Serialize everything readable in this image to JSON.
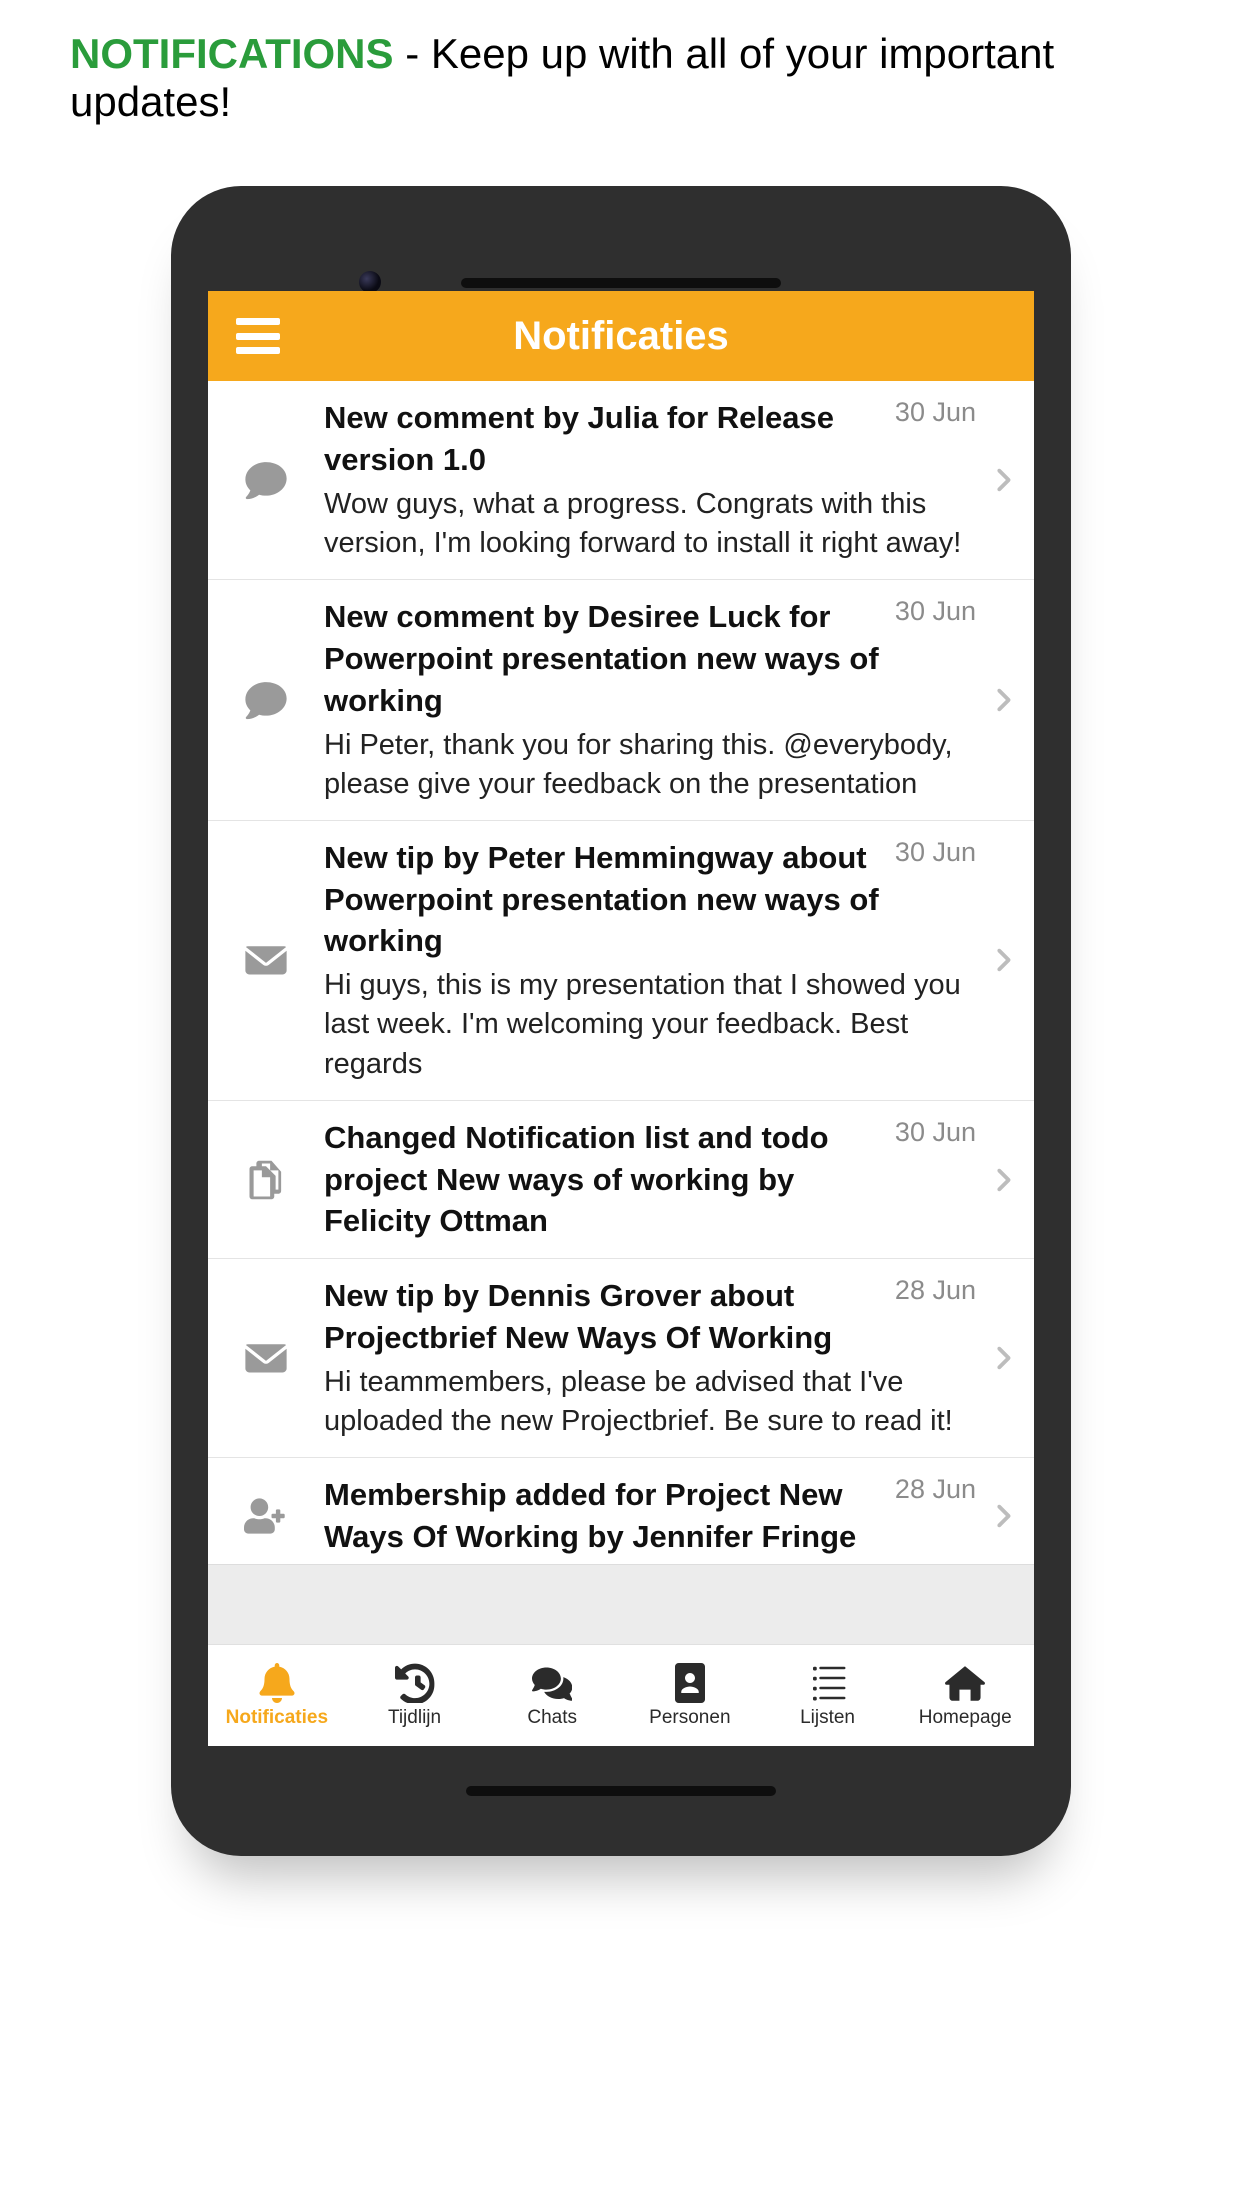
{
  "page_header": {
    "highlight": "NOTIFICATIONS",
    "rest": " - Keep up with all of your important updates!"
  },
  "app_bar": {
    "title": "Notificaties"
  },
  "notifications": [
    {
      "icon": "comment",
      "title": "New comment by Julia for Release version 1.0",
      "message": "Wow guys, what a progress. Congrats with this version, I'm looking forward to install it right away!",
      "date": "30 Jun"
    },
    {
      "icon": "comment",
      "title": "New comment by Desiree Luck for Powerpoint presentation new ways of working",
      "message": "Hi Peter, thank you for sharing this. @everybody, please give your feedback on the presentation",
      "date": "30 Jun"
    },
    {
      "icon": "envelope",
      "title": "New tip by Peter Hemmingway about Powerpoint presentation new ways of working",
      "message": "Hi guys, this is my presentation that I showed you last week. I'm welcoming your feedback. Best regards",
      "date": "30 Jun"
    },
    {
      "icon": "files",
      "title": "Changed Notification list and todo project New ways of working by Felicity Ottman",
      "message": "",
      "date": "30 Jun"
    },
    {
      "icon": "envelope",
      "title": "New tip by Dennis Grover about Projectbrief New Ways Of Working",
      "message": "Hi teammembers, please be advised that I've uploaded the new Projectbrief. Be sure to read it!",
      "date": "28 Jun"
    },
    {
      "icon": "useradd",
      "title": "Membership added for Project New Ways Of Working by Jennifer Fringe",
      "message": "",
      "date": "28 Jun"
    }
  ],
  "tabs": [
    {
      "icon": "bell",
      "label": "Notificaties",
      "active": true
    },
    {
      "icon": "history",
      "label": "Tijdlijn",
      "active": false
    },
    {
      "icon": "chats",
      "label": "Chats",
      "active": false
    },
    {
      "icon": "personen",
      "label": "Personen",
      "active": false
    },
    {
      "icon": "list",
      "label": "Lijsten",
      "active": false
    },
    {
      "icon": "home",
      "label": "Homepage",
      "active": false
    }
  ]
}
